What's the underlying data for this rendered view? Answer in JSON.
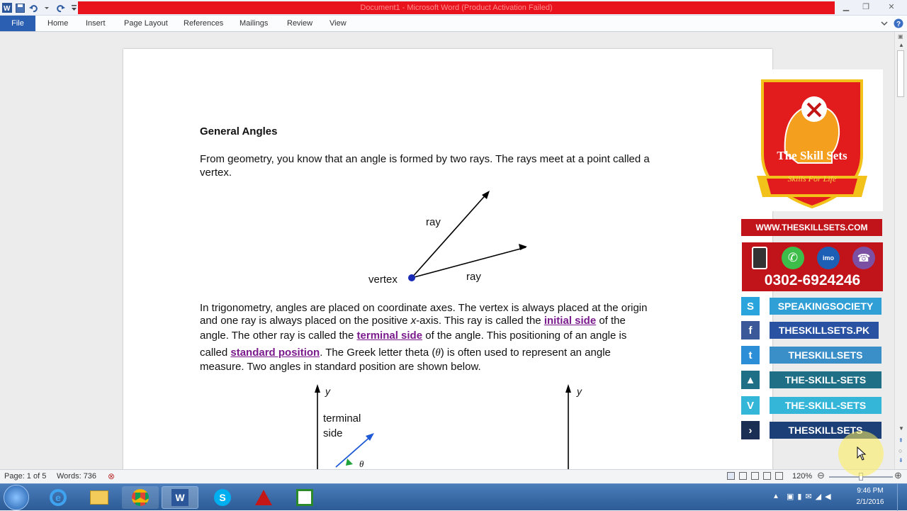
{
  "window": {
    "title": "Document1 - Microsoft Word (Product Activation Failed)"
  },
  "ribbon": {
    "file_label": "File",
    "tabs": [
      "Home",
      "Insert",
      "Page Layout",
      "References",
      "Mailings",
      "Review",
      "View"
    ]
  },
  "document": {
    "heading": "General Angles",
    "para1_line1": "From geometry, you know that an angle is formed by two rays. The rays meet at a point called a",
    "para1_line2": "vertex.",
    "figure1": {
      "ray_upper": "ray",
      "ray_lower": "ray",
      "vertex": "vertex"
    },
    "para2": {
      "l1": "In trigonometry, angles are placed on coordinate axes. The vertex is always placed at the origin",
      "l2a": "and one ray is always placed on the positive ",
      "l2x": "x",
      "l2b": "-axis. This ray is called the ",
      "initial_side": "initial side",
      "l2c": " of the",
      "l3a": "angle. The other ray is called the ",
      "terminal_side": "terminal side",
      "l3b": " of the angle. This positioning of an angle is",
      "l4a": "called ",
      "standard_position": "standard position",
      "l4b": ". The Greek letter theta (",
      "theta": "θ",
      "l4c": ") is often used to represent an angle",
      "l5": "measure. Two angles in standard position are shown below."
    },
    "figure2": {
      "y1": "y",
      "y2": "y",
      "terminal": "terminal",
      "side": "side",
      "theta": "θ"
    }
  },
  "promo": {
    "logo_title": "The Skill Sets",
    "logo_tagline": "Skills For Life",
    "website": "WWW.THESKILLSETS.COM",
    "phone": "0302-6924246",
    "imo": "imo",
    "socials": [
      {
        "label": "SPEAKINGSOCIETY",
        "icon": "skype-icon",
        "color": "#2f9fd6"
      },
      {
        "label": "THESKILLSETS.PK",
        "icon": "facebook-icon",
        "color": "#2952a3"
      },
      {
        "label": "THESKILLSETS",
        "icon": "twitter-icon",
        "color": "#3a8fc9"
      },
      {
        "label": "THE-SKILL-SETS",
        "icon": "pages-icon",
        "color": "#1f6f87"
      },
      {
        "label": "THE-SKILL-SETS",
        "icon": "vimeo-icon",
        "color": "#34b6d8"
      },
      {
        "label": "THESKILLSETS",
        "icon": "dailymotion-icon",
        "color": "#1c3f78"
      }
    ]
  },
  "status": {
    "page": "Page: 1 of 5",
    "words": "Words: 736",
    "zoom": "120%"
  },
  "clock": {
    "time": "9:46 PM",
    "date": "2/1/2016"
  }
}
